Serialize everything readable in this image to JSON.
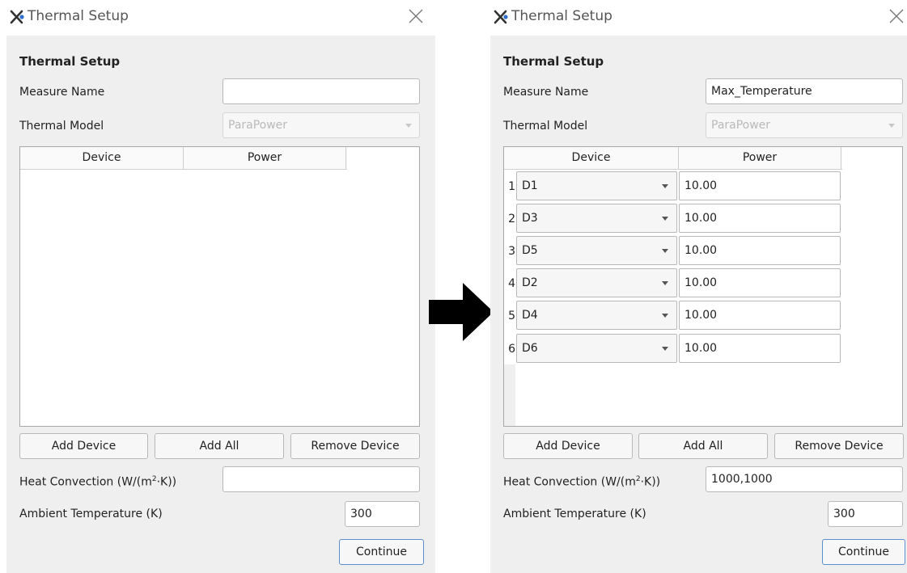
{
  "left_dialog": {
    "window_title": "Thermal Setup",
    "section_title": "Thermal Setup",
    "measure_name_label": "Measure Name",
    "measure_name_value": "",
    "thermal_model_label": "Thermal Model",
    "thermal_model_value": "ParaPower",
    "columns": [
      "Device",
      "Power"
    ],
    "add_device_label": "Add Device",
    "add_all_label": "Add All",
    "remove_device_label": "Remove Device",
    "heat_convection_label_prefix": "Heat Convection (W/(m",
    "heat_convection_label_sup": "2",
    "heat_convection_label_suffix": "·K))",
    "heat_convection_value": "",
    "ambient_label": "Ambient Temperature (K)",
    "ambient_value": "300",
    "continue_label": "Continue"
  },
  "right_dialog": {
    "window_title": "Thermal Setup",
    "section_title": "Thermal Setup",
    "measure_name_label": "Measure Name",
    "measure_name_value": "Max_Temperature",
    "thermal_model_label": "Thermal Model",
    "thermal_model_value": "ParaPower",
    "columns": [
      "Device",
      "Power"
    ],
    "rows": [
      {
        "num": "1",
        "device": "D1",
        "power": "10.00"
      },
      {
        "num": "2",
        "device": "D3",
        "power": "10.00"
      },
      {
        "num": "3",
        "device": "D5",
        "power": "10.00"
      },
      {
        "num": "4",
        "device": "D2",
        "power": "10.00"
      },
      {
        "num": "5",
        "device": "D4",
        "power": "10.00"
      },
      {
        "num": "6",
        "device": "D6",
        "power": "10.00"
      }
    ],
    "add_device_label": "Add Device",
    "add_all_label": "Add All",
    "remove_device_label": "Remove Device",
    "heat_convection_label_prefix": "Heat Convection (W/(m",
    "heat_convection_label_sup": "2",
    "heat_convection_label_suffix": "·K))",
    "heat_convection_value": "1000,1000",
    "ambient_label": "Ambient Temperature (K)",
    "ambient_value": "300",
    "continue_label": "Continue"
  },
  "icons": {
    "app": "app-x-icon",
    "close": "close-icon",
    "transition": "right-arrow-icon"
  },
  "colors": {
    "dialog_bg": "#efefef",
    "titlebar_bg": "#ffffff",
    "default_button_border": "#5a8fd0",
    "app_icon_blue": "#2f6ecb"
  }
}
